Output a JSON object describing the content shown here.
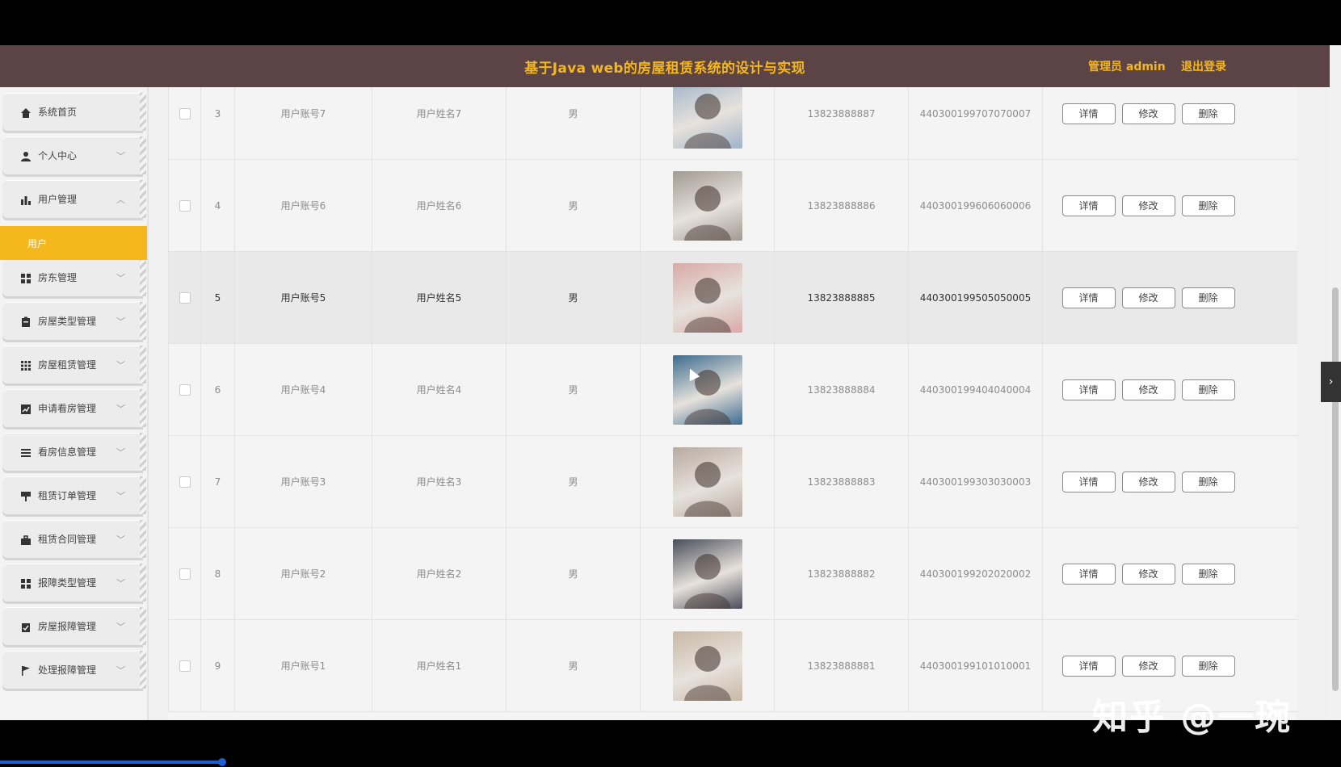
{
  "header": {
    "title": "基于Java web的房屋租赁系统的设计与实现",
    "user_label": "管理员 admin",
    "logout_label": "退出登录"
  },
  "sidebar": {
    "items": [
      {
        "label": "系统首页",
        "icon": "home-icon",
        "has_chevron": false
      },
      {
        "label": "个人中心",
        "icon": "user-icon",
        "has_chevron": true
      },
      {
        "label": "用户管理",
        "icon": "bar-chart-icon",
        "has_chevron": true,
        "expanded": true
      },
      {
        "label": "房东管理",
        "icon": "grid-icon",
        "has_chevron": true
      },
      {
        "label": "房屋类型管理",
        "icon": "clipboard-icon",
        "has_chevron": true
      },
      {
        "label": "房屋租赁管理",
        "icon": "apps-icon",
        "has_chevron": true
      },
      {
        "label": "申请看房管理",
        "icon": "line-chart-icon",
        "has_chevron": true
      },
      {
        "label": "看房信息管理",
        "icon": "list-icon",
        "has_chevron": true
      },
      {
        "label": "租赁订单管理",
        "icon": "flag-stand-icon",
        "has_chevron": true
      },
      {
        "label": "租赁合同管理",
        "icon": "briefcase-icon",
        "has_chevron": true
      },
      {
        "label": "报障类型管理",
        "icon": "grid-icon",
        "has_chevron": true
      },
      {
        "label": "房屋报障管理",
        "icon": "clipboard-check-icon",
        "has_chevron": true
      },
      {
        "label": "处理报障管理",
        "icon": "flag-icon",
        "has_chevron": true
      }
    ],
    "active_sub": "用户"
  },
  "table": {
    "rows": [
      {
        "index": "3",
        "account": "用户账号7",
        "name": "用户姓名7",
        "gender": "男",
        "phone": "13823888887",
        "id_card": "440300199707070007",
        "avatar_color": "#9fb3c9"
      },
      {
        "index": "4",
        "account": "用户账号6",
        "name": "用户姓名6",
        "gender": "男",
        "phone": "13823888886",
        "id_card": "440300199606060006",
        "avatar_color": "#a19a93"
      },
      {
        "index": "5",
        "account": "用户账号5",
        "name": "用户姓名5",
        "gender": "男",
        "phone": "13823888885",
        "id_card": "440300199505050005",
        "avatar_color": "#d9a9a6"
      },
      {
        "index": "6",
        "account": "用户账号4",
        "name": "用户姓名4",
        "gender": "男",
        "phone": "13823888884",
        "id_card": "440300199404040004",
        "avatar_color": "#3d6b8f"
      },
      {
        "index": "7",
        "account": "用户账号3",
        "name": "用户姓名3",
        "gender": "男",
        "phone": "13823888883",
        "id_card": "440300199303030003",
        "avatar_color": "#b8aaa1"
      },
      {
        "index": "8",
        "account": "用户账号2",
        "name": "用户姓名2",
        "gender": "男",
        "phone": "13823888882",
        "id_card": "440300199202020002",
        "avatar_color": "#4a4e5a"
      },
      {
        "index": "9",
        "account": "用户账号1",
        "name": "用户姓名1",
        "gender": "男",
        "phone": "13823888881",
        "id_card": "440300199101010001",
        "avatar_color": "#c9b8a5"
      }
    ],
    "actions": {
      "detail": "详情",
      "edit": "修改",
      "delete": "删除"
    }
  },
  "watermark": "知乎 @一琬",
  "colors": {
    "header_bg": "#5c4446",
    "accent": "#f4b81c"
  }
}
